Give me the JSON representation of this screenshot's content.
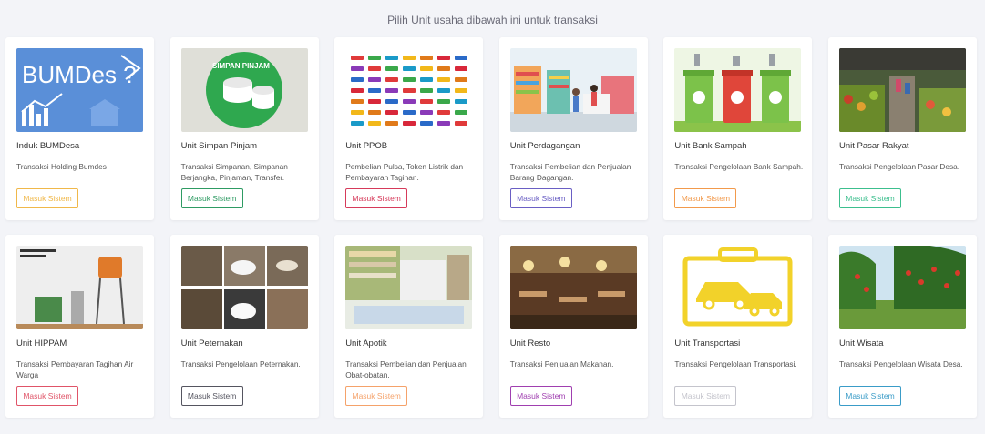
{
  "heading": "Pilih Unit usaha dibawah ini untuk transaksi",
  "units": [
    {
      "title": "Induk BUMDesa",
      "description": "Transaksi Holding Bumdes",
      "button": "Masuk Sistem",
      "color": "#f0b84a",
      "image_text": "BUMDes ?"
    },
    {
      "title": "Unit Simpan Pinjam",
      "description": "Transaksi Simpanan, Simpanan Berjangka, Pinjaman, Transfer.",
      "button": "Masuk Sistem",
      "color": "#2e9b63",
      "image_text": "SIMPAN PINJAM"
    },
    {
      "title": "Unit PPOB",
      "description": "Pembelian Pulsa, Token Listrik dan Pembayaran Tagihan.",
      "button": "Masuk Sistem",
      "color": "#d63a5a"
    },
    {
      "title": "Unit Perdagangan",
      "description": "Transaksi Pembelian dan Penjualan Barang Dagangan.",
      "button": "Masuk Sistem",
      "color": "#6a5fc4"
    },
    {
      "title": "Unit Bank Sampah",
      "description": "Transaksi Pengelolaan Bank Sampah.",
      "button": "Masuk Sistem",
      "color": "#f29a4c"
    },
    {
      "title": "Unit Pasar Rakyat",
      "description": "Transaksi Pengelolaan Pasar Desa.",
      "button": "Masuk Sistem",
      "color": "#3cbf8e"
    },
    {
      "title": "Unit HIPPAM",
      "description": "Transaksi Pembayaran Tagihan Air Warga",
      "button": "Masuk Sistem",
      "color": "#e05468"
    },
    {
      "title": "Unit Peternakan",
      "description": "Transaksi Pengelolaan Peternakan.",
      "button": "Masuk Sistem",
      "color": "#555560"
    },
    {
      "title": "Unit Apotik",
      "description": "Transaksi Pembelian dan Penjualan Obat-obatan.",
      "button": "Masuk Sistem",
      "color": "#f5a26a"
    },
    {
      "title": "Unit Resto",
      "description": "Transaksi Penjualan Makanan.",
      "button": "Masuk Sistem",
      "color": "#a03fb0"
    },
    {
      "title": "Unit Transportasi",
      "description": "Transaksi Pengelolaan Transportasi.",
      "button": "Masuk Sistem",
      "color": "#c4c4cc"
    },
    {
      "title": "Unit Wisata",
      "description": "Transaksi Pengelolaan Wisata Desa.",
      "button": "Masuk Sistem",
      "color": "#3a9cc8"
    }
  ]
}
